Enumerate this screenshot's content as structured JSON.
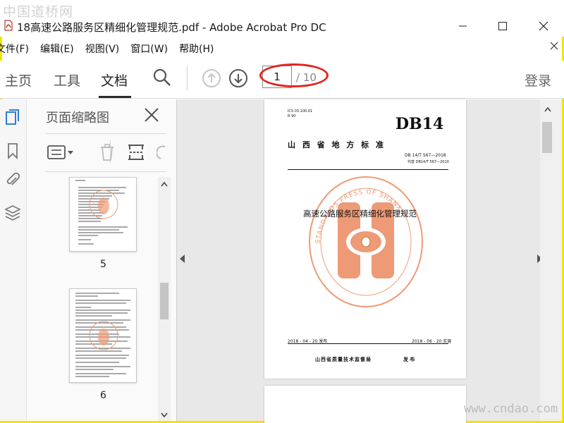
{
  "watermark_top": "中国道桥网",
  "watermark_bottom": "www.cndao.com",
  "window": {
    "title": "18高速公路服务区精细化管理规范.pdf - Adobe Acrobat Pro DC"
  },
  "menu": [
    "文件(F)",
    "编辑(E)",
    "视图(V)",
    "窗口(W)",
    "帮助(H)"
  ],
  "toolbar": {
    "tabs": [
      "主页",
      "工具",
      "文档"
    ],
    "active_tab": "文档",
    "page_current": "1",
    "page_total": "/ 10",
    "login": "登录"
  },
  "thumbnail_panel": {
    "title": "页面缩略图",
    "pages": [
      "5",
      "6"
    ]
  },
  "document": {
    "ics": "ICS  03.100.01",
    "ccs": "R 90",
    "code": "DB14",
    "province": "山  西  省  地  方  标  准",
    "std_number": "DB 14/T 567—2018",
    "replaces": "代替 DB14/T 567—2010",
    "doc_title": "高速公路服务区精细化管理规范",
    "publish": "2018 - 04 - 20 发布",
    "implement": "2018 - 06 - 20 实施",
    "issuer": "山西省质量技术监督局",
    "issuer_action": "发 布",
    "seal_text": "STANDARDS PRESS OF SHANXI"
  },
  "colors": {
    "highlight": "#e0261f",
    "seal": "#ef9a76",
    "border": "#f7e300"
  }
}
